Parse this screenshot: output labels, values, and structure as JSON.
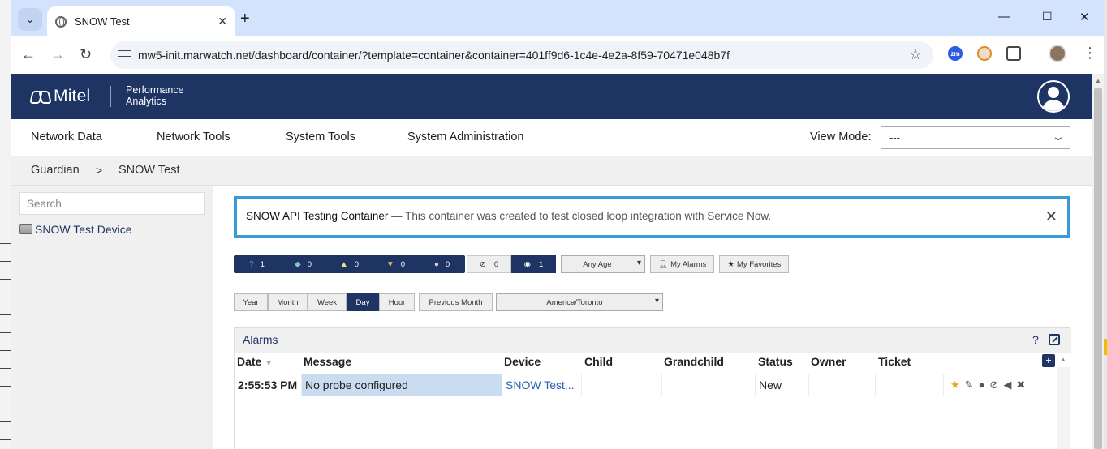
{
  "browser": {
    "tab_title": "SNOW Test",
    "url": "mw5-init.marwatch.net/dashboard/container/?template=container&container=401ff9d6-1c4e-4e2a-8f59-70471e048b7f",
    "extensions": [
      "zm",
      "onion-extension",
      "puzzle"
    ]
  },
  "app": {
    "logo": "Mitel",
    "product_line1": "Performance",
    "product_line2": "Analytics"
  },
  "nav": {
    "items": [
      "Network Data",
      "Network Tools",
      "System Tools",
      "System Administration"
    ],
    "view_mode_label": "View Mode:",
    "view_mode_value": "---"
  },
  "breadcrumb": {
    "items": [
      "Guardian",
      "SNOW Test"
    ],
    "separator": ">"
  },
  "sidebar": {
    "search_placeholder": "Search",
    "device": "SNOW Test Device"
  },
  "banner": {
    "title": "SNOW API Testing Container",
    "dash": " — ",
    "description": "This container was created to test closed loop integration with Service Now."
  },
  "filters": {
    "severity": [
      {
        "icon": "?",
        "count": "1"
      },
      {
        "icon": "◆",
        "count": "0"
      },
      {
        "icon": "▲",
        "count": "0"
      },
      {
        "icon": "▼",
        "count": "0"
      },
      {
        "icon": "●",
        "count": "0"
      }
    ],
    "hidden_count": "0",
    "visible_count": "1",
    "age": "Any Age",
    "my_alarms": "My Alarms",
    "my_favorites": "My Favorites"
  },
  "timerange": {
    "buttons": [
      "Year",
      "Month",
      "Week",
      "Day",
      "Hour"
    ],
    "active": "Day",
    "previous": "Previous Month",
    "timezone": "America/Toronto"
  },
  "alarms": {
    "title": "Alarms",
    "help": "?",
    "columns": [
      "Date",
      "Message",
      "Device",
      "Child",
      "Grandchild",
      "Status",
      "Owner",
      "Ticket"
    ],
    "sort_indicator": "▼",
    "add_column": "+",
    "rows": [
      {
        "date": "2:55:53 PM",
        "message": "No probe configured",
        "device": "SNOW Test...",
        "child": "",
        "grandchild": "",
        "status": "New",
        "owner": "",
        "ticket": ""
      }
    ]
  },
  "colors": {
    "header_bg": "#1e3563",
    "banner_border": "#3a9ad9",
    "message_highlight": "#c9dcf0",
    "favorite": "#f0a020"
  }
}
